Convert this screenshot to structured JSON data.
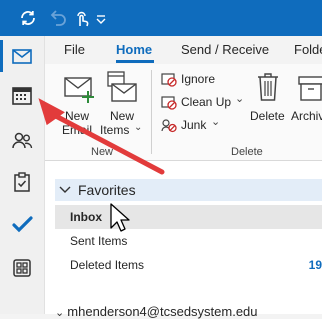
{
  "title_bar": {
    "icons": [
      "sync-icon",
      "undo-icon",
      "touch-mode-icon",
      "quick-access-dropdown-icon"
    ]
  },
  "nav_rail": {
    "items": [
      "mail-icon",
      "calendar-icon",
      "people-icon",
      "tasks-icon",
      "todo-icon",
      "apps-icon"
    ],
    "active": "mail"
  },
  "ribbon": {
    "tabs": [
      "File",
      "Home",
      "Send / Receive",
      "Folde"
    ],
    "active_tab": "Home",
    "new_group": {
      "new_email_line1": "New",
      "new_email_line2": "Email",
      "new_items_line1": "New",
      "new_items_line2": "Items",
      "label": "New"
    },
    "delete_group": {
      "ignore": "Ignore",
      "clean_up": "Clean Up",
      "junk": "Junk",
      "delete": "Delete",
      "archive": "Archiv",
      "label": "Delete"
    }
  },
  "folders": {
    "favorites_label": "Favorites",
    "items": [
      {
        "label": "Inbox",
        "count": ""
      },
      {
        "label": "Sent Items",
        "count": ""
      },
      {
        "label": "Deleted Items",
        "count": "19"
      }
    ],
    "account": "mhenderson4@tcsedsystem.edu"
  },
  "annotation": {
    "arrow_color": "#e23b3b",
    "points_to": "calendar-icon"
  },
  "colors": {
    "accent": "#0f6cbd",
    "title_bar": "#0f6cbd",
    "favorites_bg": "#e3edf8",
    "selected_row": "#e6e6e6"
  }
}
